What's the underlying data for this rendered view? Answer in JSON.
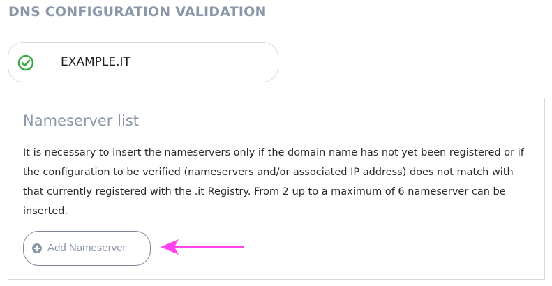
{
  "page": {
    "title": "DNS CONFIGURATION VALIDATION"
  },
  "domain": {
    "name": "EXAMPLE.IT",
    "status_icon": "check-circle-icon",
    "status_color": "#3aa845"
  },
  "nameserver_section": {
    "title": "Nameserver list",
    "description": "It is necessary to insert the nameservers only if the domain name has not yet been registered or if the configuration to be verified (nameservers and/or associated IP address) does not match with that currently registered with the .it Registry. From 2 up to a maximum of 6 nameserver can be inserted.",
    "add_button": {
      "label": "Add Nameserver",
      "icon": "plus-circle-icon"
    }
  },
  "annotation": {
    "arrow_color": "#ff44ee"
  },
  "colors": {
    "heading": "#8b97a8",
    "border": "#d5d8dc",
    "text": "#2a2a2a"
  }
}
